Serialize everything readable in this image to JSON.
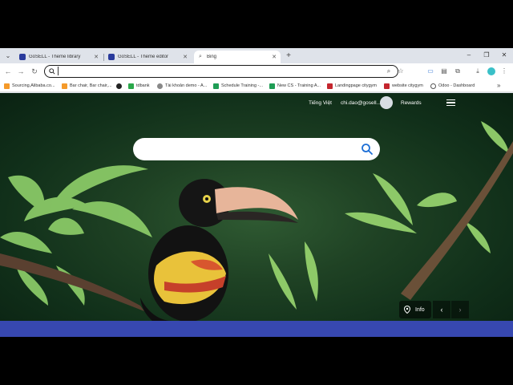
{
  "tabs": [
    {
      "title": "GoSELL - Theme library",
      "active": false
    },
    {
      "title": "GoSELL - Theme editor",
      "active": false
    },
    {
      "title": "Bing",
      "active": true
    }
  ],
  "window_controls": {
    "minimize": "–",
    "maximize": "❐",
    "close": "✕"
  },
  "toolbar": {
    "address_value": "",
    "address_placeholder": ""
  },
  "bookmarks": [
    {
      "label": "Sourcing,Alibaba.co...",
      "color": "#f59a2a"
    },
    {
      "label": "Bar chair, Bar chair,...",
      "color": "#f59a2a"
    },
    {
      "label": "",
      "color": "#222222"
    },
    {
      "label": "tdbank",
      "color": "#2aa84a"
    },
    {
      "label": "Tài khoản demo - A...",
      "color": "#888888"
    },
    {
      "label": "Schedule Training -...",
      "color": "#1f9d55"
    },
    {
      "label": "New CS - Training A...",
      "color": "#1f9d55"
    },
    {
      "label": "Landingpage citygym",
      "color": "#c4262e"
    },
    {
      "label": "website citygym",
      "color": "#c4262e"
    },
    {
      "label": "Odoo - Dashboard",
      "color": "#555555"
    }
  ],
  "bing": {
    "language_link": "Tiếng Việt",
    "account_email": "chi.dao@gosell...",
    "rewards_label": "Rewards",
    "search_value": "",
    "info_label": "Info",
    "prev_arrow": "‹",
    "next_arrow": "›"
  },
  "colors": {
    "tabstrip_bg": "#dfe3ea",
    "accent_strip": "#3748b0"
  }
}
